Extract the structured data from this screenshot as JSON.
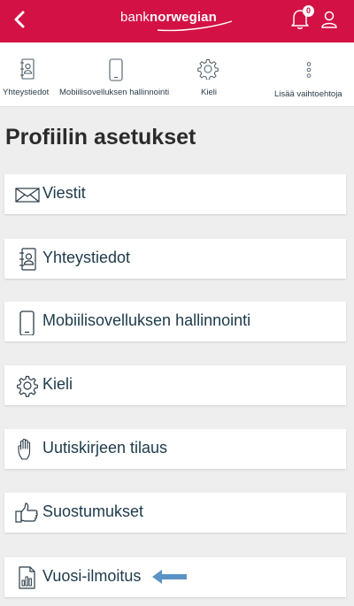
{
  "header": {
    "logo_part1": "bank",
    "logo_part2": "norwegian",
    "notification_count": "0",
    "colors": {
      "brand": "#d31145",
      "accent_arrow": "#5b93c7"
    }
  },
  "quick_nav": [
    {
      "label": "Yhteystiedot",
      "icon": "contact-book-icon"
    },
    {
      "label": "Mobiilisovelluksen hallinnointi",
      "icon": "mobile-phone-icon"
    },
    {
      "label": "Kieli",
      "icon": "gear-icon"
    },
    {
      "label": "Lisää vaihtoehtoja",
      "icon": "more-vertical-icon"
    }
  ],
  "page": {
    "title": "Profiilin asetukset"
  },
  "menu": [
    {
      "label": "Viestit",
      "icon": "envelope-icon"
    },
    {
      "label": "Yhteystiedot",
      "icon": "contact-book-icon"
    },
    {
      "label": "Mobiilisovelluksen hallinnointi",
      "icon": "mobile-phone-icon"
    },
    {
      "label": "Kieli",
      "icon": "gear-icon"
    },
    {
      "label": "Uutiskirjeen tilaus",
      "icon": "hand-icon"
    },
    {
      "label": "Suostumukset",
      "icon": "thumbs-up-icon"
    },
    {
      "label": "Vuosi-ilmoitus",
      "icon": "report-document-icon"
    }
  ]
}
